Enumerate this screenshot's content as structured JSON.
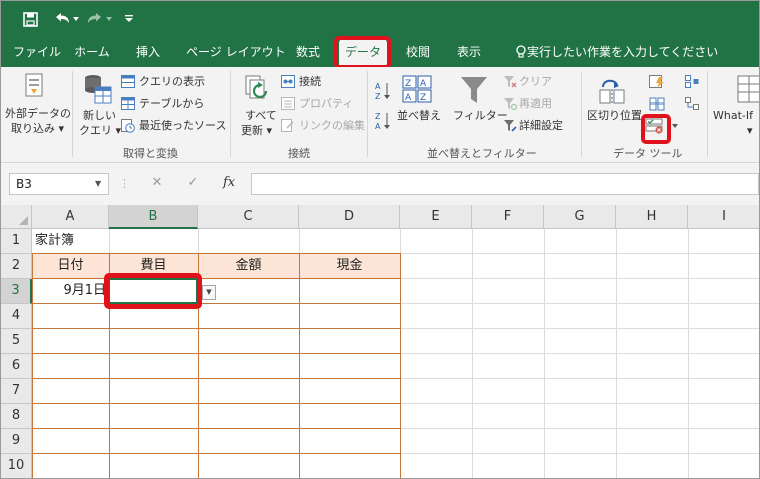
{
  "qat": {
    "save_icon": "save-icon",
    "undo_icon": "undo-icon",
    "redo_icon": "redo-icon",
    "customize_icon": "customize-qat-icon"
  },
  "tabs": [
    {
      "label": "ファイル"
    },
    {
      "label": "ホーム"
    },
    {
      "label": "挿入"
    },
    {
      "label": "ページ レイアウト"
    },
    {
      "label": "数式"
    },
    {
      "label": "データ",
      "active": true
    },
    {
      "label": "校閲"
    },
    {
      "label": "表示"
    },
    {
      "label": "実行したい作業を入力してください"
    }
  ],
  "ribbon": {
    "external_data": {
      "line1": "外部データの",
      "line2": "取り込み ▾"
    },
    "new_query": {
      "line1": "新しい",
      "line2": "クエリ ▾"
    },
    "show_query": "クエリの表示",
    "from_table": "テーブルから",
    "recent_sources": "最近使ったソース",
    "group_get_transform": "取得と変換",
    "refresh_all": {
      "line1": "すべて",
      "line2": "更新 ▾"
    },
    "connections": "接続",
    "properties": "プロパティ",
    "edit_links": "リンクの編集",
    "group_connections": "接続",
    "sort": "並べ替え",
    "filter": "フィルター",
    "clear": "クリア",
    "reapply": "再適用",
    "advanced": "詳細設定",
    "group_sort_filter": "並べ替えとフィルター",
    "text_to_columns": "区切り位置",
    "group_data_tools": "データ ツール",
    "what_if": {
      "line1": "What-If",
      "line2": "▾"
    }
  },
  "formula_bar": {
    "name_box": "B3",
    "cancel": "✕",
    "enter": "✓",
    "fx": "fx",
    "value": ""
  },
  "grid": {
    "columns": [
      "A",
      "B",
      "C",
      "D",
      "E",
      "F",
      "G",
      "H",
      "I"
    ],
    "rows": [
      "1",
      "2",
      "3",
      "4",
      "5",
      "6",
      "7",
      "8",
      "9",
      "10"
    ],
    "title": "家計簿",
    "headers": [
      "日付",
      "費目",
      "金額",
      "現金"
    ],
    "row3_date": "9月1日",
    "active_cell": "B3"
  },
  "colors": {
    "excel_green": "#217346",
    "highlight_red": "#e0131c",
    "header_fill": "#fce4d6",
    "table_border": "#c4773b"
  }
}
